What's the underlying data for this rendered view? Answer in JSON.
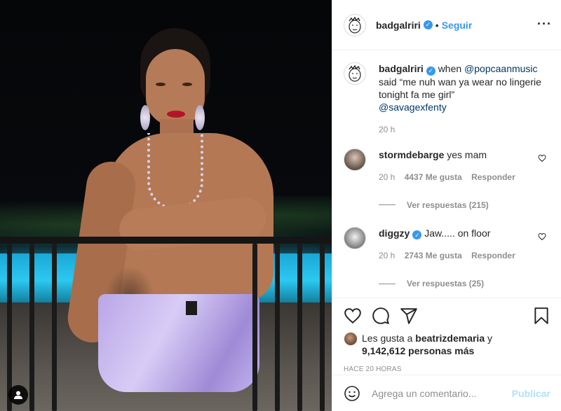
{
  "header": {
    "username": "badgalriri",
    "separator": "•",
    "follow_label": "Seguir",
    "more_icon": "···"
  },
  "caption": {
    "username": "badgalriri",
    "text_prefix": "when ",
    "mention1": "@popcaanmusic",
    "text_body": " said “me nuh wan ya wear no lingerie tonight fa me girl”",
    "mention2": "@savagexfenty",
    "time": "20 h"
  },
  "comments": [
    {
      "username": "stormdebarge",
      "text": "yes mam",
      "time": "20 h",
      "likes": "4437 Me gusta",
      "reply_label": "Responder",
      "view_replies": "Ver respuestas (215)"
    },
    {
      "username": "diggzy",
      "text": "Jaw..... on floor",
      "time": "20 h",
      "likes": "2743 Me gusta",
      "reply_label": "Responder",
      "view_replies": "Ver respuestas (25)"
    }
  ],
  "likes": {
    "prefix": "Les gusta a ",
    "user": "beatrizdemaria",
    "conj": " y",
    "count": "9,142,612 personas más"
  },
  "timestamp": "HACE 20 HORAS",
  "composer": {
    "placeholder": "Agrega un comentario...",
    "post_label": "Publicar"
  },
  "colors": {
    "accent": "#3897f0",
    "post_disabled": "#b2dffc",
    "muted": "#8e8e8e",
    "text": "#262626",
    "mention": "#00376b"
  },
  "icons": [
    "more-options-icon",
    "verified-icon",
    "heart-icon",
    "comment-icon",
    "share-icon",
    "bookmark-icon",
    "emoji-icon",
    "user-tag-icon"
  ]
}
